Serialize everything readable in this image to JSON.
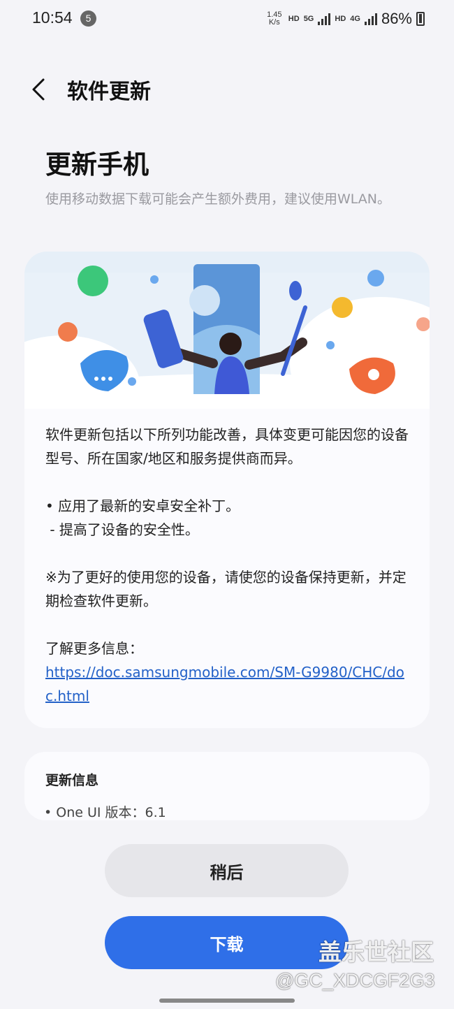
{
  "status_bar": {
    "time": "10:54",
    "notification_count": "5",
    "net_speed_value": "1.45",
    "net_speed_unit": "K/s",
    "hd_1": "HD",
    "net_5g": "5G",
    "hd_2": "HD",
    "net_4g": "4G",
    "battery_percent": "86%"
  },
  "top_bar": {
    "title": "软件更新",
    "back_icon": "chevron-left-icon"
  },
  "page": {
    "heading": "更新手机",
    "notice": "使用移动数据下载可能会产生额外费用，建议使用WLAN。"
  },
  "description": {
    "intro": "软件更新包括以下所列功能改善，具体变更可能因您的设备型号、所在国家/地区和服务提供商而异。",
    "bullet": "• 应用了最新的安卓安全补丁。",
    "sub_bullet": " - 提高了设备的安全性。",
    "note": "※为了更好的使用您的设备，请使您的设备保持更新，并定期检查软件更新。",
    "more_info_label": "了解更多信息：",
    "link": "https://doc.samsungmobile.com/SM-G9980/CHC/doc.html"
  },
  "update_info": {
    "title": "更新信息",
    "version_line": "• One UI 版本：6.1"
  },
  "buttons": {
    "later": "稍后",
    "download": "下载"
  },
  "watermark": {
    "brand": "盖乐世社区",
    "user": "@GC_XDCGF2G3"
  },
  "colors": {
    "accent": "#2f6fe8",
    "link": "#2361c8",
    "background": "#f4f4f8",
    "card": "#fbfbfe"
  }
}
